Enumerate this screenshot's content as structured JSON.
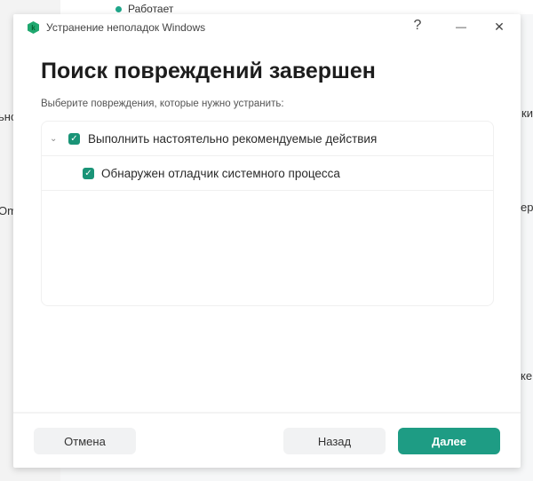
{
  "background": {
    "status": "Работает",
    "fragments": [
      "ьнс",
      "ки",
      "Om",
      "ер",
      "кен"
    ]
  },
  "dialog": {
    "title": "Устранение неполадок Windows",
    "help": "?",
    "minimize": "—",
    "close": "✕",
    "heading": "Поиск повреждений завершен",
    "subtitle": "Выберите повреждения, которые нужно устранить:",
    "items": [
      {
        "label": "Выполнить настоятельно рекомендуемые действия",
        "checked": true,
        "expanded": true
      },
      {
        "label": "Обнаружен отладчик системного процесса",
        "checked": true
      }
    ],
    "buttons": {
      "cancel": "Отмена",
      "back": "Назад",
      "next": "Далее"
    }
  },
  "colors": {
    "accent": "#1e9c84"
  }
}
